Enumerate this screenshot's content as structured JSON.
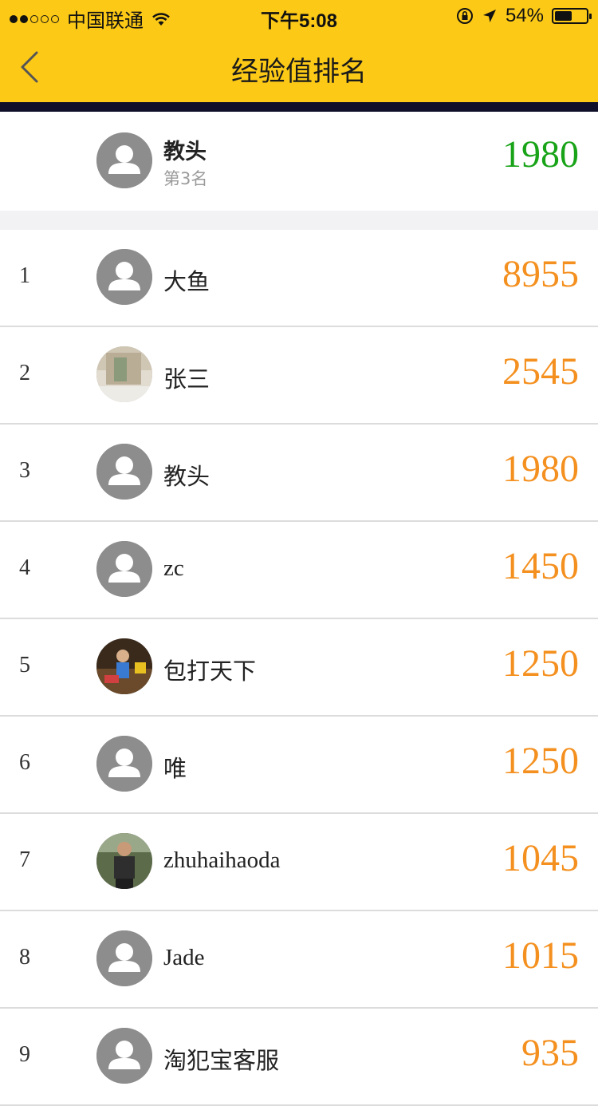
{
  "status_bar": {
    "carrier": "中国联通",
    "time": "下午5:08",
    "battery": "54%",
    "battery_level": 0.54,
    "signal_icon": "signal-dots-icon",
    "wifi_icon": "wifi-icon",
    "lock_icon": "orientation-lock-icon",
    "location_icon": "location-arrow-icon"
  },
  "nav": {
    "title": "经验值排名",
    "back_icon": "chevron-left-icon"
  },
  "colors": {
    "brand_yellow": "#fcc917",
    "score_orange": "#f4901f",
    "my_score_green": "#18a318"
  },
  "my_rank": {
    "name": "教头",
    "position": "第3名",
    "score": "1980"
  },
  "ranking": [
    {
      "rank": "1",
      "name": "大鱼",
      "score": "8955"
    },
    {
      "rank": "2",
      "name": "张三",
      "score": "2545"
    },
    {
      "rank": "3",
      "name": "教头",
      "score": "1980"
    },
    {
      "rank": "4",
      "name": "zc",
      "score": "1450"
    },
    {
      "rank": "5",
      "name": "包打天下",
      "score": "1250"
    },
    {
      "rank": "6",
      "name": "唯",
      "score": "1250"
    },
    {
      "rank": "7",
      "name": "zhuhaihaoda",
      "score": "1045"
    },
    {
      "rank": "8",
      "name": "Jade",
      "score": "1015"
    },
    {
      "rank": "9",
      "name": "淘犯宝客服",
      "score": "935"
    }
  ]
}
